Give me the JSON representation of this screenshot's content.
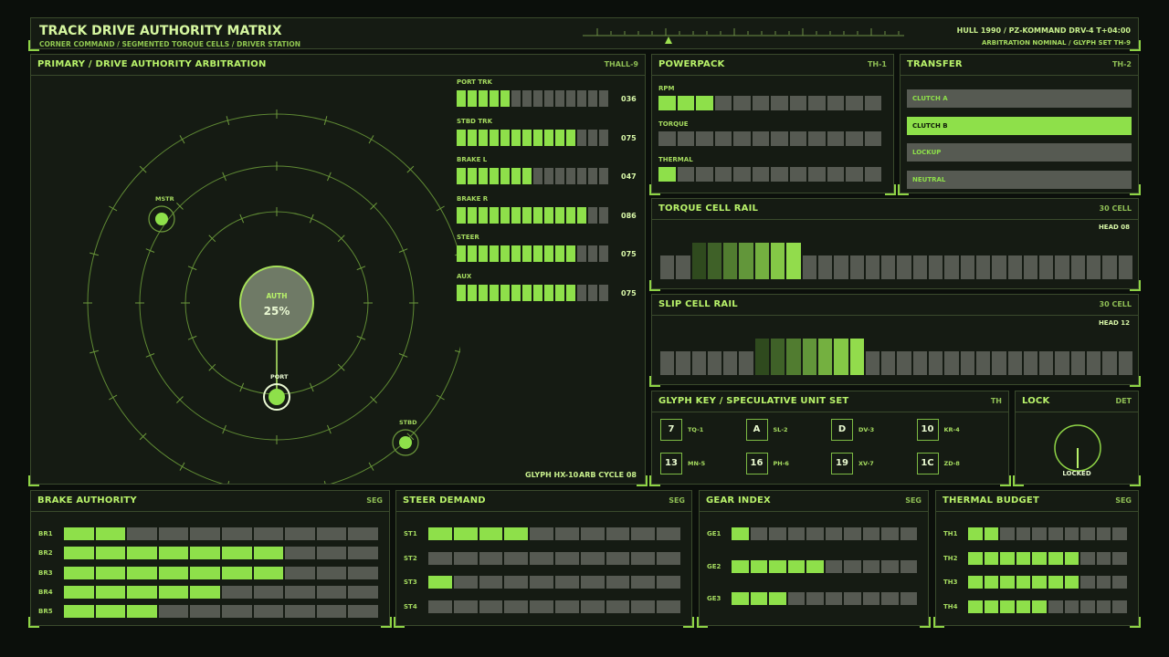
{
  "header": {
    "title": "TRACK DRIVE AUTHORITY MATRIX",
    "subtitle": "CORNER COMMAND / SEGMENTED TORQUE CELLS / DRIVER STATION",
    "right_line1": "HULL 1990 / PZ-KOMMAND  DRV-4  T+04:00",
    "right_line2": "ARBITRATION NOMINAL / GLYPH SET TH-9"
  },
  "primary": {
    "title": "PRIMARY / DRIVE AUTHORITY ARBITRATION",
    "tag": "THALL-9",
    "center_label": "AUTH",
    "center_value": "25%",
    "nodes": {
      "mstr": "MSTR",
      "port": "PORT",
      "stbd": "STBD"
    },
    "footer_glyph": "GLYPH  HX-10",
    "footer_cycle": "ARB CYCLE 08",
    "bars": [
      {
        "label": "PORT TRK",
        "value": "036",
        "level": 5
      },
      {
        "label": "STBD TRK",
        "value": "075",
        "level": 11
      },
      {
        "label": "BRAKE L",
        "value": "047",
        "level": 7
      },
      {
        "label": "BRAKE R",
        "value": "086",
        "level": 12
      },
      {
        "label": "STEER",
        "value": "075",
        "level": 11
      },
      {
        "label": "AUX",
        "value": "075",
        "level": 11
      }
    ]
  },
  "powerpack": {
    "title": "POWERPACK",
    "tag": "TH-1",
    "rows": [
      {
        "label": "RPM",
        "level": 3
      },
      {
        "label": "TORQUE",
        "level": 0
      },
      {
        "label": "THERMAL",
        "level": 1
      }
    ]
  },
  "transfer": {
    "title": "TRANSFER",
    "tag": "TH-2",
    "options": [
      "CLUTCH A",
      "CLUTCH B",
      "LOCKUP",
      "NEUTRAL"
    ],
    "selected": "CLUTCH B"
  },
  "torque_rail": {
    "title": "TORQUE CELL RAIL",
    "tag": "30 CELL",
    "head": "HEAD 08",
    "start": 2,
    "count": 7
  },
  "slip_rail": {
    "title": "SLIP CELL RAIL",
    "tag": "30 CELL",
    "head": "HEAD 12",
    "start": 6,
    "count": 7
  },
  "glyph_key": {
    "title": "GLYPH KEY / SPECULATIVE UNIT SET",
    "tag": "TH",
    "items": [
      {
        "glyph": "7",
        "name": "TQ-1"
      },
      {
        "glyph": "A",
        "name": "SL-2"
      },
      {
        "glyph": "D",
        "name": "DV-3"
      },
      {
        "glyph": "10",
        "name": "KR-4"
      },
      {
        "glyph": "13",
        "name": "MN-5"
      },
      {
        "glyph": "16",
        "name": "PH-6"
      },
      {
        "glyph": "19",
        "name": "XV-7"
      },
      {
        "glyph": "1C",
        "name": "ZD-8"
      }
    ]
  },
  "lock": {
    "title": "LOCK",
    "tag": "DET",
    "status": "LOCKED"
  },
  "brake": {
    "title": "BRAKE AUTHORITY",
    "tag": "SEG",
    "rows": [
      {
        "label": "BR1",
        "level": 2
      },
      {
        "label": "BR2",
        "level": 7
      },
      {
        "label": "BR3",
        "level": 7
      },
      {
        "label": "BR4",
        "level": 5
      },
      {
        "label": "BR5",
        "level": 3
      }
    ]
  },
  "steer": {
    "title": "STEER DEMAND",
    "tag": "SEG",
    "rows": [
      {
        "label": "ST1",
        "level": 4
      },
      {
        "label": "ST2",
        "level": 0
      },
      {
        "label": "ST3",
        "level": 1
      },
      {
        "label": "ST4",
        "level": 0
      }
    ]
  },
  "gear": {
    "title": "GEAR INDEX",
    "tag": "SEG",
    "rows": [
      {
        "label": "GE1",
        "level": 1
      },
      {
        "label": "GE2",
        "level": 5
      },
      {
        "label": "GE3",
        "level": 3
      }
    ]
  },
  "thermal": {
    "title": "THERMAL BUDGET",
    "tag": "SEG",
    "rows": [
      {
        "label": "TH1",
        "level": 2
      },
      {
        "label": "TH2",
        "level": 7
      },
      {
        "label": "TH3",
        "level": 7
      },
      {
        "label": "TH4",
        "level": 5
      }
    ]
  },
  "colors": {
    "accent": "#8ee04a",
    "off": "#565a52",
    "frame": "#3a4a2c"
  }
}
